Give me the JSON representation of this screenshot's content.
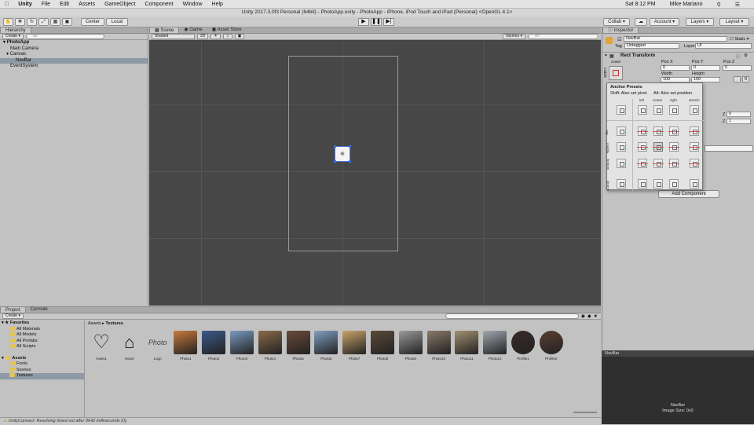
{
  "menubar": {
    "apple": "",
    "app": "Unity",
    "items": [
      "File",
      "Edit",
      "Assets",
      "GameObject",
      "Component",
      "Window",
      "Help"
    ],
    "right": {
      "time": "Sat 8:12 PM",
      "user": "Mike Mariano"
    }
  },
  "titlebar": {
    "text": "Unity 2017.3.0f3 Personal (64bit) - PhotoApp.unity - PhotoApp - iPhone, iPod Touch and iPad (Personal) <OpenGL 4.1>"
  },
  "toolbar": {
    "center": "Center",
    "local": "Local",
    "collab": "Collab ▾",
    "account": "Account ▾",
    "layers": "Layers ▾",
    "layout": "Layout ▾"
  },
  "hierarchy": {
    "tab": "Hierarchy",
    "create": "Create ▾",
    "search_placeholder": "All",
    "items": [
      {
        "label": "PhotoApp",
        "level": 0
      },
      {
        "label": "Main Camera",
        "level": 1
      },
      {
        "label": "Canvas",
        "level": 1
      },
      {
        "label": "NavBar",
        "level": 2,
        "selected": true
      },
      {
        "label": "EventSystem",
        "level": 1
      }
    ]
  },
  "scene": {
    "tabs": [
      "Scene",
      "Game",
      "Asset Store"
    ],
    "shaded": "Shaded",
    "mode2d": "2D",
    "gizmos": "Gizmos ▾",
    "search_placeholder": "All"
  },
  "inspector": {
    "tab": "Inspector",
    "object_name": "NavBar",
    "static": "Static",
    "tag_label": "Tag",
    "tag": "Untagged",
    "layer_label": "Layer",
    "layer": "UI",
    "component": "Rect Transform",
    "anchor_label": "center",
    "anchor_side": "middle",
    "posx_label": "Pos X",
    "posy_label": "Pos Y",
    "posz_label": "Pos Z",
    "posx": "0",
    "posy": "0",
    "posz": "0",
    "width_label": "Width",
    "height_label": "Height",
    "width": "100",
    "height": "100",
    "z1": "0",
    "z2": "1",
    "add_component": "Add Component"
  },
  "anchor_popup": {
    "title": "Anchor Presets",
    "shift_hint": "Shift: Also set pivot",
    "alt_hint": "Alt: Also set position",
    "cols": [
      "left",
      "center",
      "right",
      "stretch"
    ],
    "rows": [
      "top",
      "middle",
      "bottom",
      "stretch"
    ]
  },
  "project": {
    "tabs": [
      "Project",
      "Console"
    ],
    "create": "Create ▾",
    "favorites": "Favorites",
    "fav_items": [
      "All Materials",
      "All Models",
      "All Prefabs",
      "All Scripts"
    ],
    "assets": "Assets",
    "asset_folders": [
      "Fonts",
      "Scenes",
      "Textures"
    ],
    "breadcrumb_root": "Assets",
    "breadcrumb_sep": "▸",
    "breadcrumb_current": "Textures",
    "items": [
      {
        "name": "Heart1"
      },
      {
        "name": "Home"
      },
      {
        "name": "Logo",
        "text": "Photo"
      },
      {
        "name": "Photo1"
      },
      {
        "name": "Photo2"
      },
      {
        "name": "Photo3"
      },
      {
        "name": "Photo4"
      },
      {
        "name": "Photo5"
      },
      {
        "name": "Photo6"
      },
      {
        "name": "Photo7"
      },
      {
        "name": "Photo8"
      },
      {
        "name": "Photo9"
      },
      {
        "name": "Photo10"
      },
      {
        "name": "Photo11"
      },
      {
        "name": "Photo12"
      },
      {
        "name": "Profile1"
      },
      {
        "name": "Profile2"
      }
    ]
  },
  "preview": {
    "header": "NavBar",
    "name": "NavBar",
    "size": "Image Size: 0x0"
  },
  "status": {
    "text": "UnityConnect: Resolving timed out after 9642 milliseconds (0)."
  }
}
